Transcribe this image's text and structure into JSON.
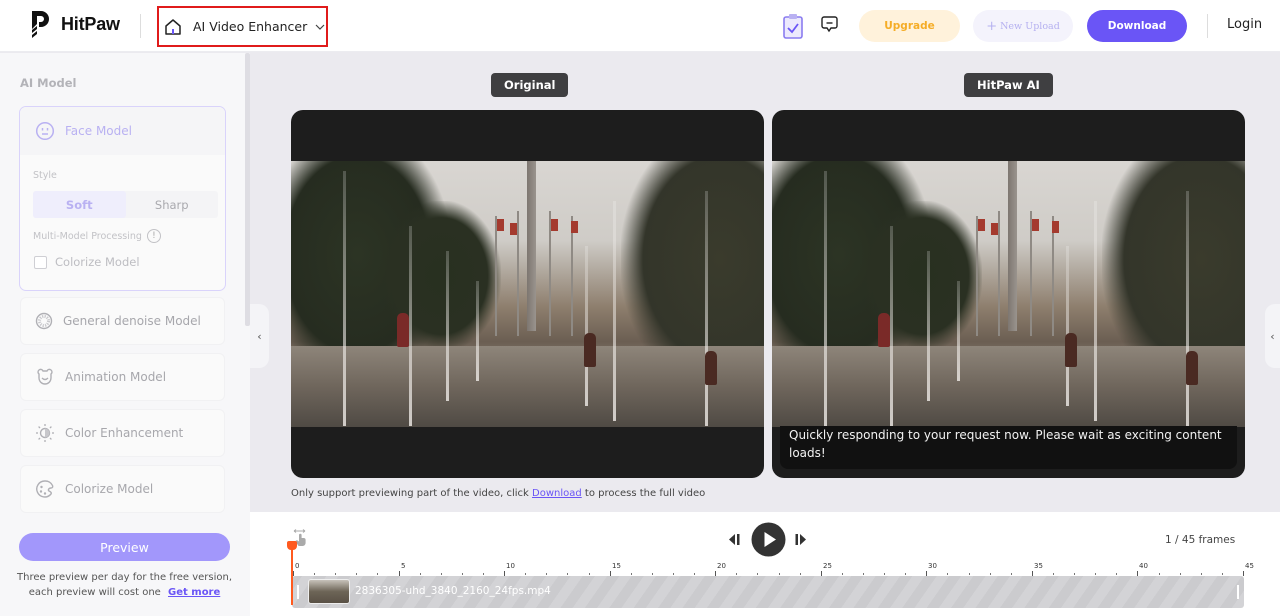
{
  "header": {
    "brand": "HitPaw",
    "tool_selector": "AI Video Enhancer",
    "upgrade": "Upgrade",
    "new_upload": "New Upload",
    "new_upload_icon": "+",
    "download": "Download",
    "login": "Login"
  },
  "sidebar": {
    "title": "AI Model",
    "face_model": {
      "name": "Face Model",
      "style_label": "Style",
      "styles": [
        "Soft",
        "Sharp"
      ],
      "selected_style": "Soft",
      "multi_model_label": "Multi-Model Processing",
      "info_icon": "!",
      "colorize_checkbox_label": "Colorize Model",
      "colorize_checked": false
    },
    "models": [
      {
        "name": "General denoise Model",
        "icon": "denoise-icon"
      },
      {
        "name": "Animation Model",
        "icon": "bear-icon"
      },
      {
        "name": "Color Enhancement",
        "icon": "sun-icon"
      },
      {
        "name": "Colorize Model",
        "icon": "palette-icon"
      }
    ],
    "preview_button": "Preview",
    "note_text": "Three preview per day for the free version, each preview will cost one",
    "note_link": "Get more"
  },
  "preview": {
    "original_label": "Original",
    "ai_label": "HitPaw AI",
    "loading_message": "Quickly responding to your request now. Please wait as exciting content loads!",
    "hint_before": "Only support previewing part of the video, click ",
    "hint_link": "Download",
    "hint_after": " to process the full video",
    "collapse_left": "‹",
    "collapse_right": "‹"
  },
  "timeline": {
    "frame_counter": "1 / 45 frames",
    "current_frame": 1,
    "total_frames": 45,
    "ruler_labels": [
      "0",
      "5",
      "10",
      "15",
      "20",
      "25",
      "30",
      "35",
      "40",
      "45"
    ],
    "file_name": "2836305-uhd_3840_2160_24fps.mp4"
  }
}
